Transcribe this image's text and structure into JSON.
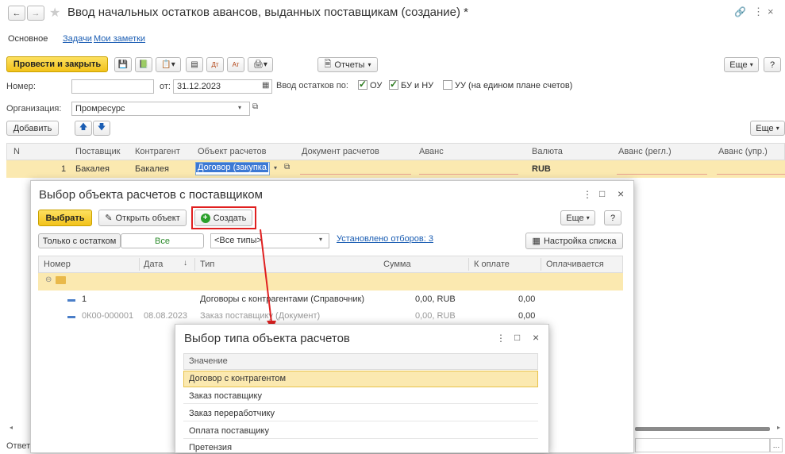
{
  "title_bar": {
    "title": "Ввод начальных остатков авансов, выданных поставщикам (создание) *",
    "back_icon": "arrow-left",
    "forward_icon": "arrow-right",
    "favorite_icon": "star",
    "link_icon": "link",
    "more_icon": "more-vertical",
    "close_icon": "close"
  },
  "tabs": [
    "Основное",
    "Задачи",
    "Мои заметки"
  ],
  "toolbar": {
    "post_close_label": "Провести и закрыть",
    "reports_label": "Отчеты",
    "more_label": "Еще",
    "help_label": "?"
  },
  "header": {
    "number_label": "Номер:",
    "number_value": "",
    "date_prefix": "от:",
    "date_value": "31.12.2023",
    "balances_label": "Ввод остатков по:",
    "ou_label": "ОУ",
    "ou_checked": true,
    "bu_label": "БУ и НУ",
    "bu_checked": true,
    "uu_label": "УУ (на едином плане счетов)",
    "uu_checked": false,
    "org_label": "Организация:",
    "org_value": "Промресурс"
  },
  "table_toolbar": {
    "add_label": "Добавить",
    "more_label": "Еще"
  },
  "table": {
    "columns": [
      "N",
      "Поставщик",
      "Контрагент",
      "Объект расчетов",
      "Документ расчетов",
      "Аванс",
      "Валюта",
      "Аванс (регл.)",
      "Аванс (упр.)"
    ],
    "rows": [
      {
        "n": "1",
        "supplier": "Бакалея",
        "counterparty": "Бакалея",
        "object": "Договор (закупка",
        "document": "",
        "advance": "",
        "currency": "RUB",
        "advance_reg": "",
        "advance_mgmt": ""
      }
    ]
  },
  "answer_label": "Ответ",
  "dialog1": {
    "title": "Выбор объекта расчетов с поставщиком",
    "select_label": "Выбрать",
    "open_label": "Открыть объект",
    "create_label": "Создать",
    "more_label": "Еще",
    "help_label": "?",
    "filter_only_label": "Только с остатком",
    "filter_all_label": "Все",
    "type_value": "<Все типы>",
    "filters_link": "Установлено отборов: 3",
    "list_settings_label": "Настройка списка",
    "columns": [
      "Номер",
      "Дата",
      "Тип",
      "Сумма",
      "К оплате",
      "Оплачивается"
    ],
    "rows": [
      {
        "number": "1",
        "date": "",
        "type": "Договоры с контрагентами (Справочник)",
        "sum": "0,00, RUB",
        "to_pay": "0,00",
        "paying": ""
      },
      {
        "number": "0К00-000001",
        "date": "08.08.2023",
        "type": "Заказ поставщику (Документ)",
        "sum": "0,00, RUB",
        "to_pay": "0,00",
        "paying": ""
      }
    ]
  },
  "dialog2": {
    "title": "Выбор типа объекта расчетов",
    "column": "Значение",
    "items": [
      "Договор с контрагентом",
      "Заказ поставщику",
      "Заказ переработчику",
      "Оплата поставщику",
      "Претензия"
    ],
    "selected_index": 0
  },
  "colors": {
    "accent_yellow": "#f2c21a",
    "selected_row": "#fbe9b0",
    "link_blue": "#1a5db3",
    "highlight_red": "#e02020"
  }
}
